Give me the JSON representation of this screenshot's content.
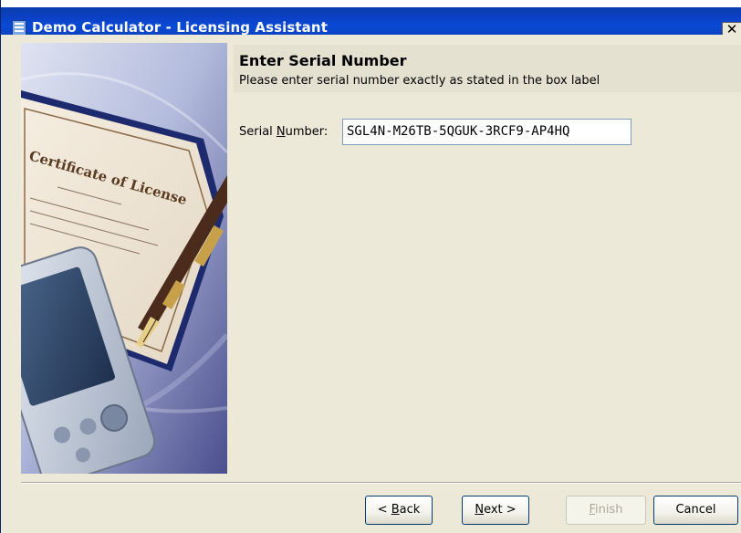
{
  "window": {
    "title": "Demo Calculator - Licensing Assistant",
    "close_label": "✕"
  },
  "header": {
    "title": "Enter Serial Number",
    "subtitle": "Please enter serial number exactly as stated in the box label"
  },
  "form": {
    "serial_label_pre": "Serial ",
    "serial_label_mnemonic": "N",
    "serial_label_post": "umber:",
    "serial_value": "SGL4N-M26TB-5QGUK-3RCF9-AP4HQ"
  },
  "buttons": {
    "back_prefix": "< ",
    "back_mnemonic": "B",
    "back_rest": "ack",
    "next_mnemonic": "N",
    "next_rest": "ext >",
    "finish_mnemonic": "F",
    "finish_rest": "inish",
    "finish_enabled": false,
    "cancel": "Cancel"
  },
  "image": {
    "certificate_title": "Certificate of License"
  }
}
